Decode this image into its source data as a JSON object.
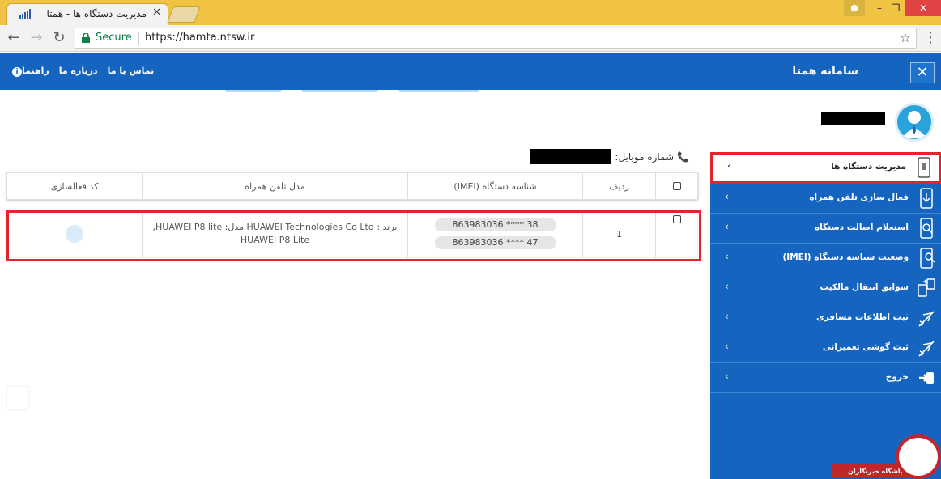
{
  "browser": {
    "tab_title": "مدیریت دستگاه ها - همتا",
    "tab_close": "✕",
    "secure_label": "Secure",
    "url": "https://hamta.ntsw.ir",
    "window_buttons": {
      "minimize": "–",
      "maximize": "❐",
      "close": "✕"
    }
  },
  "header": {
    "title": "سامانه همتا",
    "links": {
      "contact": "تماس با ما",
      "about": "درباره ما",
      "help": "راهنما"
    },
    "colors": {
      "primary": "#1565c0",
      "highlight": "#e3242b"
    }
  },
  "main": {
    "mobile_label": "شماره موبایل:",
    "table": {
      "headers": {
        "index": "ردیف",
        "imei": "شناسه دستگاه (IMEI)",
        "model": "مدل تلفن همراه",
        "activation": "کد فعالسازی"
      },
      "rows": [
        {
          "index": "1",
          "imei": [
            "863983036 **** 38",
            "863983036 **** 47"
          ],
          "model_line1": "برند : HUAWEI Technologies Co Ltd مدل: HUAWEI P8 lite,",
          "model_line2": "HUAWEI P8 Lite",
          "activation": ""
        }
      ]
    }
  },
  "sidebar": {
    "items": [
      {
        "label": "مدیریت دستگاه ها",
        "icon": "phone-manage-icon",
        "active": true
      },
      {
        "label": "فعال سازی تلفن همراه",
        "icon": "phone-activate-icon"
      },
      {
        "label": "استعلام اصالت دستگاه",
        "icon": "phone-search-icon"
      },
      {
        "label": "وضعیت شناسه دستگاه (IMEI)",
        "icon": "phone-status-icon"
      },
      {
        "label": "سوابق انتقال مالکیت",
        "icon": "transfer-icon"
      },
      {
        "label": "ثبت اطلاعات مسافری",
        "icon": "plane-icon"
      },
      {
        "label": "ثبت گوشی تعمیراتی",
        "icon": "plane-repair-icon"
      },
      {
        "label": "خروج",
        "icon": "logout-icon"
      }
    ]
  },
  "watermark": {
    "text": "باشگاه خبرنگاران"
  }
}
